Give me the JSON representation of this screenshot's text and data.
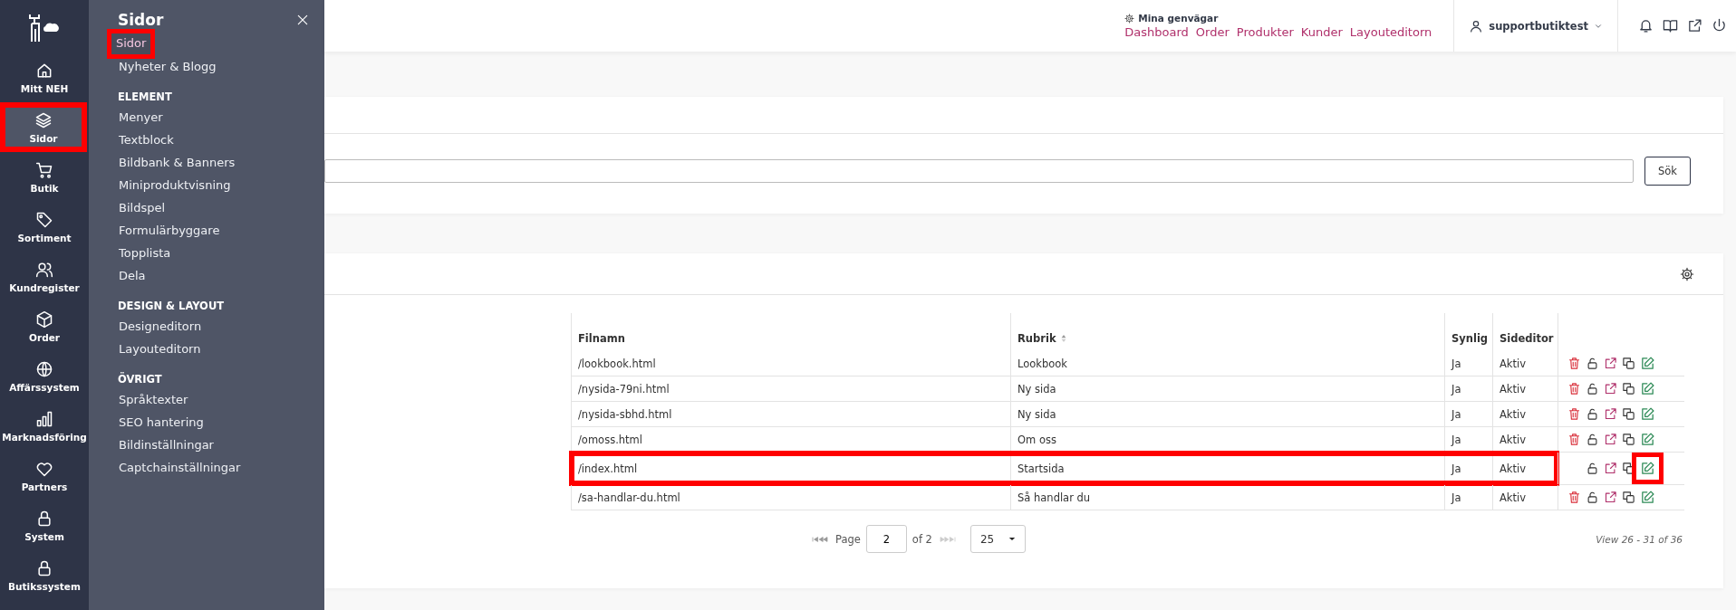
{
  "rail": {
    "items": [
      {
        "label": "Mitt NEH",
        "kind": "home",
        "selected": false,
        "highlighted": false
      },
      {
        "label": "Sidor",
        "kind": "layers",
        "selected": true,
        "highlighted": true
      },
      {
        "label": "Butik",
        "kind": "cart",
        "selected": false,
        "highlighted": false
      },
      {
        "label": "Sortiment",
        "kind": "tag",
        "selected": false,
        "highlighted": false
      },
      {
        "label": "Kundregister",
        "kind": "users",
        "selected": false,
        "highlighted": false
      },
      {
        "label": "Order",
        "kind": "box",
        "selected": false,
        "highlighted": false
      },
      {
        "label": "Affärssystem",
        "kind": "globe",
        "selected": false,
        "highlighted": false
      },
      {
        "label": "Marknadsföring",
        "kind": "bars",
        "selected": false,
        "highlighted": false
      },
      {
        "label": "Partners",
        "kind": "heart",
        "selected": false,
        "highlighted": false
      },
      {
        "label": "System",
        "kind": "lock",
        "selected": false,
        "highlighted": false
      },
      {
        "label": "Butikssystem",
        "kind": "lock",
        "selected": false,
        "highlighted": false
      }
    ]
  },
  "panel": {
    "title": "Sidor",
    "sections": [
      {
        "items": [
          {
            "label": "Sidor",
            "selected": true,
            "highlighted": true
          },
          {
            "label": "Nyheter & Blogg",
            "selected": false,
            "highlighted": false
          }
        ]
      },
      {
        "heading": "ELEMENT",
        "items": [
          {
            "label": "Menyer",
            "selected": false,
            "highlighted": false
          },
          {
            "label": "Textblock",
            "selected": false,
            "highlighted": false
          },
          {
            "label": "Bildbank & Banners",
            "selected": false,
            "highlighted": false
          },
          {
            "label": "Miniproduktvisning",
            "selected": false,
            "highlighted": false
          },
          {
            "label": "Bildspel",
            "selected": false,
            "highlighted": false
          },
          {
            "label": "Formulärbyggare",
            "selected": false,
            "highlighted": false
          },
          {
            "label": "Topplista",
            "selected": false,
            "highlighted": false
          },
          {
            "label": "Dela",
            "selected": false,
            "highlighted": false
          }
        ]
      },
      {
        "heading": "DESIGN & LAYOUT",
        "items": [
          {
            "label": "Designeditorn",
            "selected": false,
            "highlighted": false
          },
          {
            "label": "Layouteditorn",
            "selected": false,
            "highlighted": false
          }
        ]
      },
      {
        "heading": "ÖVRIGT",
        "items": [
          {
            "label": "Språktexter",
            "selected": false,
            "highlighted": false
          },
          {
            "label": "SEO hantering",
            "selected": false,
            "highlighted": false
          },
          {
            "label": "Bildinställningar",
            "selected": false,
            "highlighted": false
          },
          {
            "label": "Captchainställningar",
            "selected": false,
            "highlighted": false
          }
        ]
      }
    ]
  },
  "header": {
    "shortcuts_label": "Mina genvägar",
    "shortcuts": [
      "Dashboard",
      "Order",
      "Produkter",
      "Kunder",
      "Layouteditorn"
    ],
    "user": "supportbutiktest"
  },
  "search": {
    "button": "Sök"
  },
  "table": {
    "columns": [
      {
        "label": "Filnamn",
        "sortable": false
      },
      {
        "label": "Rubrik",
        "sortable": true
      },
      {
        "label": "Synlig",
        "sortable": false
      },
      {
        "label": "Sideditor",
        "sortable": false
      }
    ],
    "rows": [
      {
        "filename": "/lookbook.html",
        "title": "Lookbook",
        "visible": "Ja",
        "editor": "Aktiv",
        "can_delete": true,
        "highlighted": false,
        "edit_highlighted": false
      },
      {
        "filename": "/nysida-79ni.html",
        "title": "Ny sida",
        "visible": "Ja",
        "editor": "Aktiv",
        "can_delete": true,
        "highlighted": false,
        "edit_highlighted": false
      },
      {
        "filename": "/nysida-sbhd.html",
        "title": "Ny sida",
        "visible": "Ja",
        "editor": "Aktiv",
        "can_delete": true,
        "highlighted": false,
        "edit_highlighted": false
      },
      {
        "filename": "/omoss.html",
        "title": "Om oss",
        "visible": "Ja",
        "editor": "Aktiv",
        "can_delete": true,
        "highlighted": false,
        "edit_highlighted": false
      },
      {
        "filename": "/index.html",
        "title": "Startsida",
        "visible": "Ja",
        "editor": "Aktiv",
        "can_delete": false,
        "highlighted": true,
        "edit_highlighted": true
      },
      {
        "filename": "/sa-handlar-du.html",
        "title": "Så handlar du",
        "visible": "Ja",
        "editor": "Aktiv",
        "can_delete": true,
        "highlighted": false,
        "edit_highlighted": false
      }
    ]
  },
  "pagination": {
    "page_label": "Page",
    "page": "2",
    "of": "of 2",
    "page_size": "25",
    "view": "View 26 - 31 of 36"
  }
}
